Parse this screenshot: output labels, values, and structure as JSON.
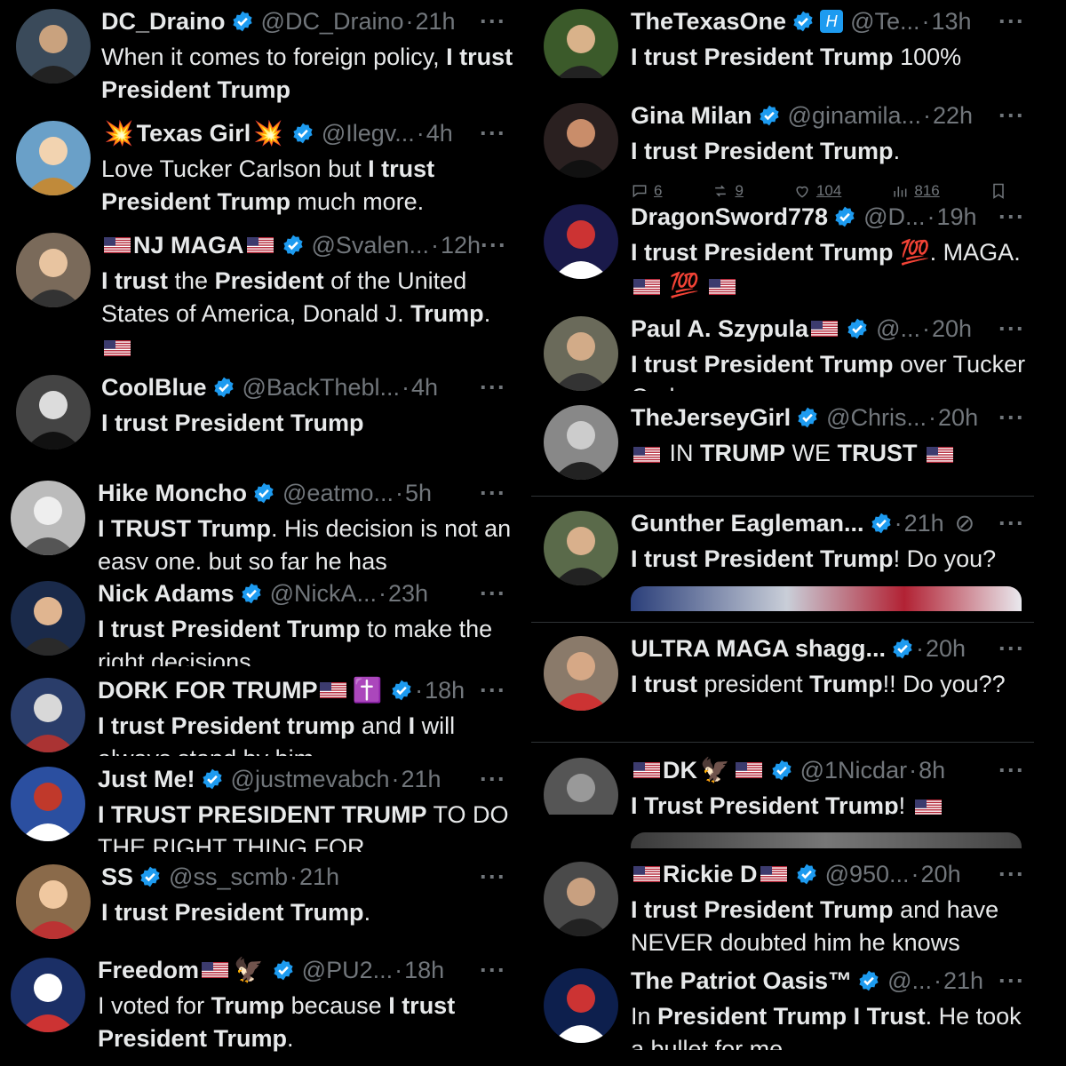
{
  "left_column": [
    {
      "name": "DC_Draino",
      "handle": "@DC_Draino",
      "time": "21h",
      "body": [
        [
          "n",
          "When it comes to foreign policy, "
        ],
        [
          "b",
          "I trust President Trump"
        ]
      ]
    },
    {
      "name": "Texas Girl",
      "name_prefix": "💥",
      "name_suffix": "💥",
      "handle": "@Ilegv...",
      "time": "4h",
      "body": [
        [
          "n",
          "Love Tucker Carlson but "
        ],
        [
          "b",
          "I trust President Trump"
        ],
        [
          "n",
          " much more."
        ]
      ]
    },
    {
      "name": "NJ MAGA",
      "flags_around_name": true,
      "handle": "@Svalen...",
      "time": "12h",
      "body": [
        [
          "b",
          "I trust"
        ],
        [
          "n",
          " the "
        ],
        [
          "b",
          "President"
        ],
        [
          "n",
          " of the United States of America, Donald J. "
        ],
        [
          "b",
          "Trump"
        ],
        [
          "n",
          ". "
        ],
        [
          "f",
          "us"
        ]
      ]
    },
    {
      "name": "CoolBlue",
      "handle": "@BackThebl...",
      "time": "4h",
      "body": [
        [
          "b",
          "I trust President Trump"
        ]
      ]
    },
    {
      "name": "Hike Moncho",
      "handle": "@eatmo...",
      "time": "5h",
      "body": [
        [
          "b",
          "I TRUST Trump"
        ],
        [
          "n",
          ".  His decision is not an easy one, but so far he has"
        ]
      ]
    },
    {
      "name": "Nick Adams",
      "handle": "@NickA...",
      "time": "23h",
      "body": [
        [
          "b",
          "I trust President Trump"
        ],
        [
          "n",
          " to make the right decisions"
        ]
      ]
    },
    {
      "name": "DORK FOR TRUMP",
      "name_suffix": "✝️",
      "flag_after_name": true,
      "handle": "",
      "time": "18h",
      "body": [
        [
          "b",
          "I trust President trump"
        ],
        [
          "n",
          " and "
        ],
        [
          "b",
          "I"
        ],
        [
          "n",
          " will always stand by him"
        ]
      ]
    },
    {
      "name": "Just Me!",
      "handle": "@justmevabch",
      "time": "21h",
      "body": [
        [
          "b",
          "I TRUST PRESIDENT TRUMP"
        ],
        [
          "n",
          " TO DO THE RIGHT THING FOR"
        ]
      ]
    },
    {
      "name": "SS",
      "handle": "@ss_scmb",
      "time": "21h",
      "body": [
        [
          "b",
          "I trust President Trump"
        ],
        [
          "n",
          "."
        ]
      ]
    },
    {
      "name": "Freedom",
      "flag_after_name": true,
      "name_suffix": "🦅",
      "handle": "@PU2...",
      "time": "18h",
      "body": [
        [
          "n",
          "I voted for "
        ],
        [
          "b",
          "Trump"
        ],
        [
          "n",
          " because "
        ],
        [
          "b",
          "I trust President Trump"
        ],
        [
          "n",
          "."
        ]
      ]
    }
  ],
  "right_column": [
    {
      "name": "TheTexasOne",
      "badge": "H",
      "handle": "@Te...",
      "time": "13h",
      "body": [
        [
          "b",
          "I trust President Trump"
        ],
        [
          "n",
          " 100%"
        ]
      ]
    },
    {
      "name": "Gina Milan",
      "handle": "@ginamila...",
      "time": "22h",
      "body": [
        [
          "b",
          "I trust President Trump"
        ],
        [
          "n",
          "."
        ]
      ],
      "stats": {
        "replies": "6",
        "reposts": "9",
        "likes": "104",
        "views": "816"
      }
    },
    {
      "name": "DragonSword778",
      "handle": "@D...",
      "time": "19h",
      "body": [
        [
          "b",
          "I trust President Trump"
        ],
        [
          "n",
          " 💯. MAGA. "
        ],
        [
          "f",
          "us"
        ],
        [
          "n",
          " 💯 "
        ],
        [
          "f",
          "us"
        ]
      ]
    },
    {
      "name": "Paul A. Szypula",
      "flag_after_name": true,
      "handle": "@...",
      "time": "20h",
      "body": [
        [
          "b",
          "I trust President Trump"
        ],
        [
          "n",
          " over Tucker Carlson"
        ]
      ]
    },
    {
      "name": "TheJerseyGirl",
      "handle": "@Chris...",
      "time": "20h",
      "body": [
        [
          "f",
          "us"
        ],
        [
          "n",
          " IN "
        ],
        [
          "b",
          "TRUMP"
        ],
        [
          "n",
          " WE "
        ],
        [
          "b",
          "TRUST"
        ],
        [
          "n",
          " "
        ],
        [
          "f",
          "us"
        ]
      ]
    },
    {
      "name": "Gunther Eagleman...",
      "handle": "",
      "time": "21h",
      "muted": true,
      "body": [
        [
          "b",
          "I trust President Trump"
        ],
        [
          "n",
          "!  Do you?"
        ]
      ]
    },
    {
      "name": "ULTRA MAGA shagg...",
      "handle": "",
      "time": "20h",
      "body": [
        [
          "b",
          "I trust"
        ],
        [
          "n",
          " president "
        ],
        [
          "b",
          "Trump"
        ],
        [
          "n",
          "!! Do you??"
        ]
      ]
    },
    {
      "name": "DK",
      "flags_around_name": true,
      "name_suffix": "🦅",
      "handle": "@1Nicdar",
      "time": "8h",
      "body": [
        [
          "b",
          "I Trust President Trump"
        ],
        [
          "n",
          "! "
        ],
        [
          "f",
          "us"
        ]
      ]
    },
    {
      "name": "Rickie D",
      "flags_around_name": true,
      "handle": "@950...",
      "time": "20h",
      "body": [
        [
          "b",
          "I trust President Trump"
        ],
        [
          "n",
          " and have NEVER doubted him he knows"
        ]
      ]
    },
    {
      "name": "The Patriot Oasis™",
      "handle": "@...",
      "time": "21h",
      "body": [
        [
          "n",
          "In "
        ],
        [
          "b",
          "President Trump I Trust"
        ],
        [
          "n",
          ". He took a bullet for me"
        ]
      ]
    }
  ],
  "more_label": "···",
  "dot": "·",
  "colors": {
    "background": "#000000",
    "text": "#e7e9ea",
    "muted": "#71767b",
    "verified": "#1d9bf0",
    "separator": "#2f3336"
  },
  "icons": [
    "verified-badge-icon",
    "more-icon",
    "us-flag-icon",
    "reply-icon",
    "repost-icon",
    "like-icon",
    "views-icon",
    "bookmark-icon",
    "share-icon",
    "mute-icon"
  ]
}
